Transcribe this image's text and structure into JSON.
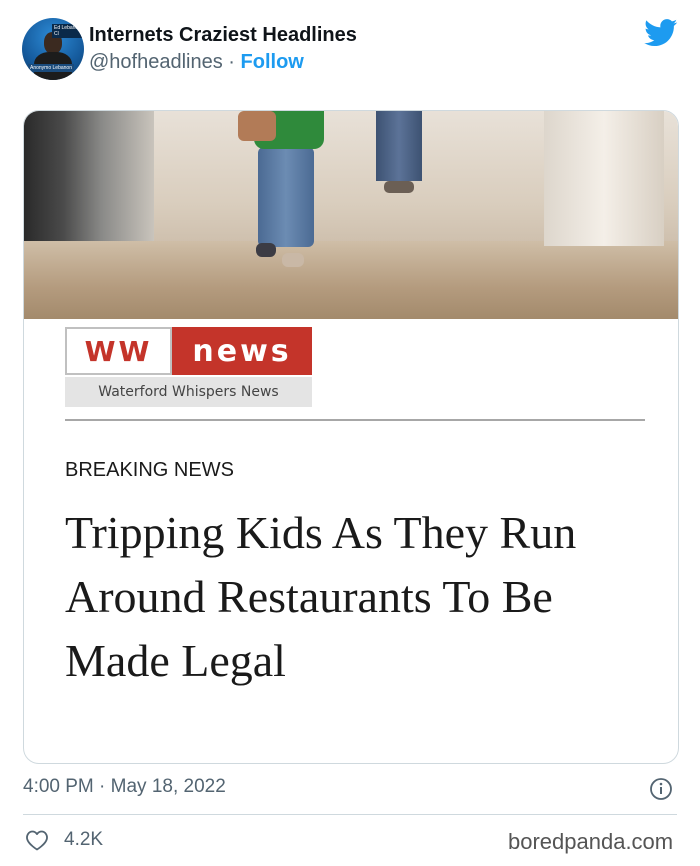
{
  "tweet": {
    "display_name": "Internets Craziest Headlines",
    "handle": "@hofheadlines",
    "separator": "·",
    "follow_label": "Follow",
    "timestamp": "4:00 PM · May 18, 2022",
    "likes": "4.2K"
  },
  "avatar_badge_top": "Ed Lebanon Cl",
  "avatar_badge_bottom": "Anonymo Lebanon",
  "article": {
    "logo_left": "WW",
    "logo_right": "news",
    "logo_subtitle": "Waterford Whispers News",
    "section": "BREAKING NEWS",
    "headline": "Tripping Kids As They Run Around Restaurants To Be Made Legal"
  },
  "watermark": "boredpanda.com",
  "colors": {
    "twitter_blue": "#1d9bf0",
    "ww_red": "#c4342a",
    "muted_text": "#536471"
  }
}
